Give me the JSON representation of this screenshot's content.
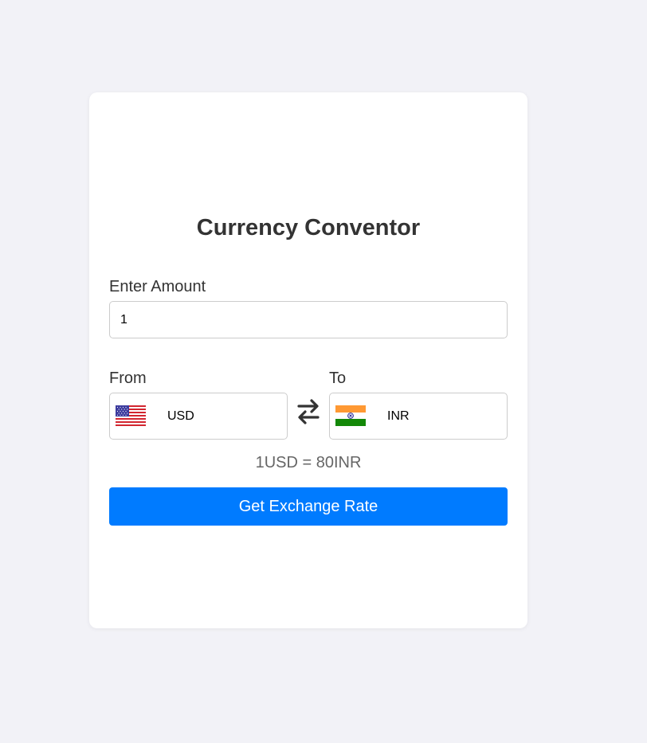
{
  "converter": {
    "title": "Currency Conventor",
    "amount_label": "Enter Amount",
    "amount_value": "1",
    "from_label": "From",
    "to_label": "To",
    "from_currency": {
      "code": "USD",
      "flag_icon": "us-flag-icon"
    },
    "to_currency": {
      "code": "INR",
      "flag_icon": "india-flag-icon"
    },
    "swap_icon": "swap-arrows-icon",
    "rate_text": "1USD = 80INR",
    "button_label": "Get Exchange Rate"
  },
  "colors": {
    "page_background": "#f2f2f7",
    "card_background": "#ffffff",
    "button_background": "#007bff",
    "button_text": "#ffffff",
    "title_text": "#333333",
    "rate_text": "#666666"
  }
}
